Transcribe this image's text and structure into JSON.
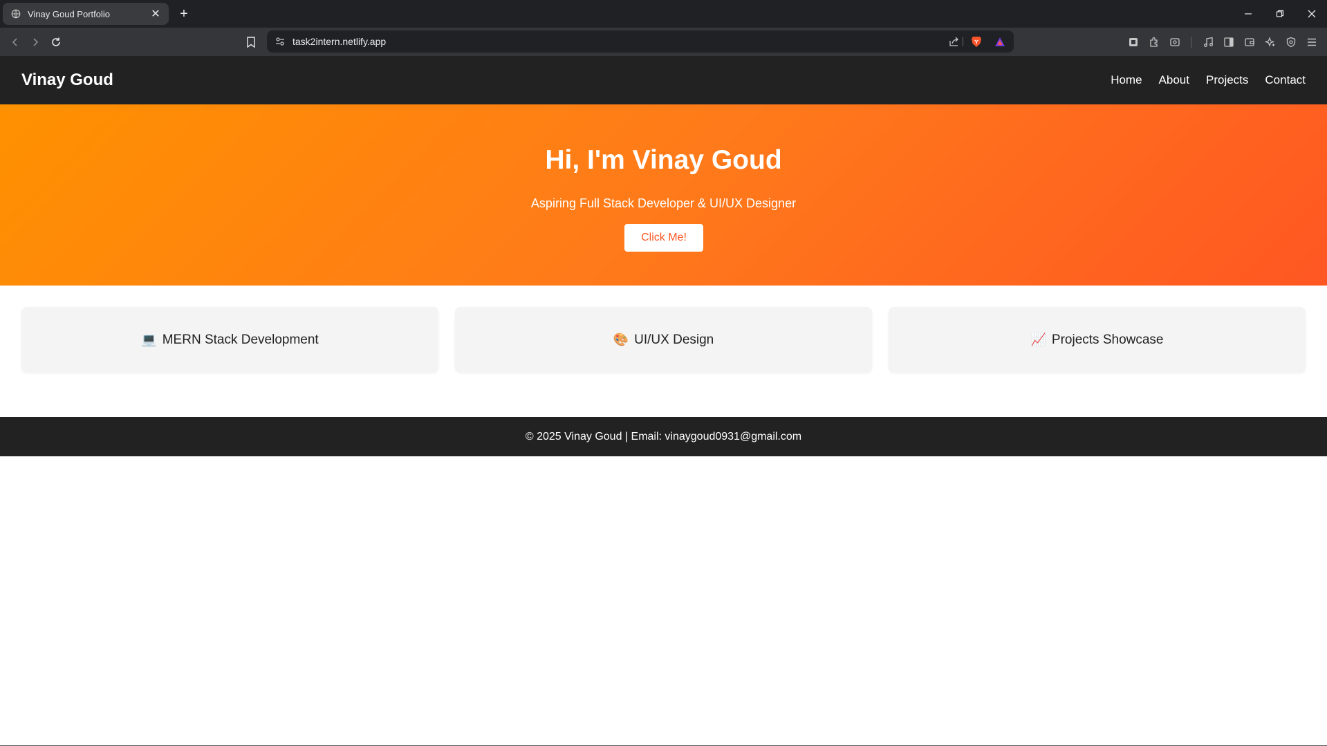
{
  "browser": {
    "tab_title": "Vinay Goud Portfolio",
    "tab_close": "✕",
    "new_tab": "+",
    "url": "task2intern.netlify.app",
    "window": {
      "minimize": "—",
      "maximize": "❐",
      "close": "✕"
    },
    "icons": {
      "back": "chevron-left-icon",
      "forward": "chevron-right-icon",
      "reload": "reload-icon",
      "bookmark": "bookmark-icon",
      "site-info": "tune-icon",
      "share": "share-icon",
      "brave-shield": "brave-lion-icon",
      "rewards": "triangle-rewards-icon",
      "extensions": [
        "puzzle-icon",
        "screenshot-icon",
        "music-icon",
        "sidebar-icon",
        "wallet-icon",
        "leo-ai-icon",
        "vpn-shield-icon",
        "menu-icon"
      ]
    }
  },
  "nav": {
    "logo": "Vinay Goud",
    "links": [
      "Home",
      "About",
      "Projects",
      "Contact"
    ]
  },
  "hero": {
    "heading": "Hi, I'm Vinay Goud",
    "subheading": "Aspiring Full Stack Developer & UI/UX Designer",
    "button": "Click Me!",
    "gradient_start": "#ff9100",
    "gradient_end": "#ff5722"
  },
  "services": [
    {
      "emoji": "💻",
      "label": "MERN Stack Development"
    },
    {
      "emoji": "🎨",
      "label": "UI/UX Design"
    },
    {
      "emoji": "📈",
      "label": "Projects Showcase"
    }
  ],
  "footer": {
    "text": "© 2025 Vinay Goud | Email: vinaygoud0931@gmail.com"
  },
  "colors": {
    "navbar": "#222222",
    "card_bg": "#f4f4f4",
    "accent": "#ff5722"
  }
}
